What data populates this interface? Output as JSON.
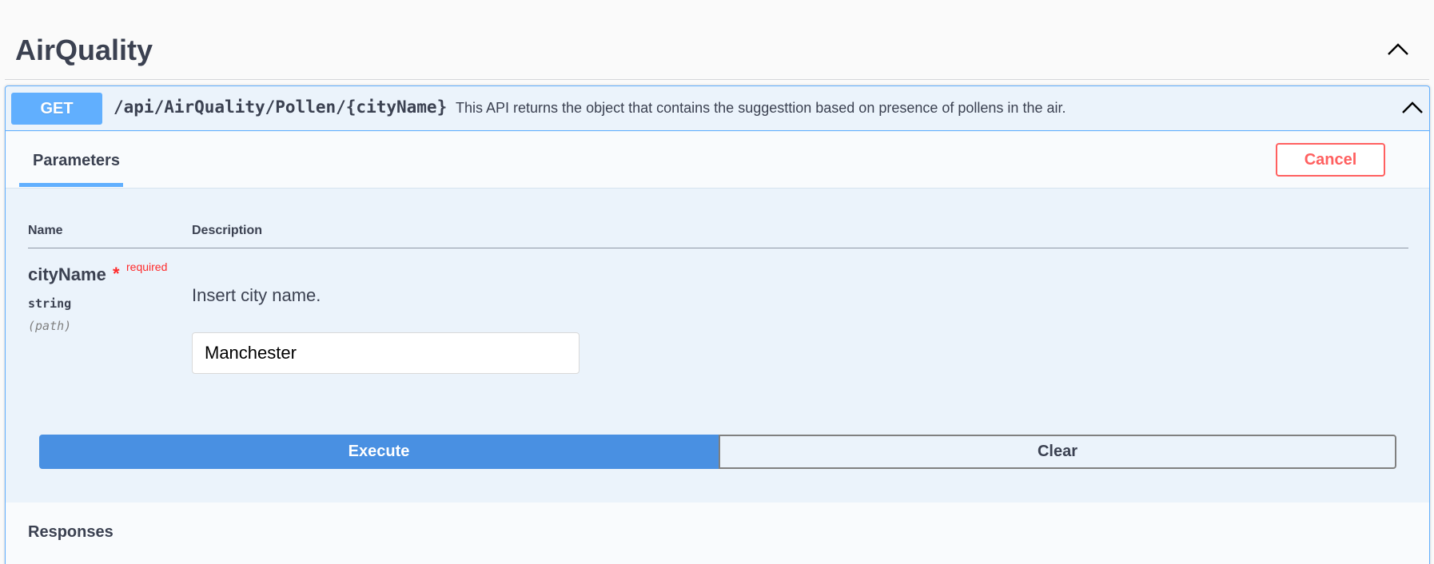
{
  "tag": {
    "title": "AirQuality",
    "collapse_icon": "chevron-up-icon"
  },
  "operation": {
    "method": "GET",
    "path": "/api/AirQuality/Pollen/{cityName}",
    "summary": "This API returns the object that contains the suggesttion based on presence of pollens in the air.",
    "collapse_icon": "chevron-up-icon",
    "method_color": "#61affe"
  },
  "parameters_section": {
    "tab_label": "Parameters",
    "cancel_label": "Cancel",
    "columns": {
      "name": "Name",
      "description": "Description"
    },
    "params": [
      {
        "name": "cityName",
        "required_star": "*",
        "required_label": "required",
        "type": "string",
        "in": "(path)",
        "description": "Insert city name.",
        "value": "Manchester"
      }
    ]
  },
  "actions": {
    "execute_label": "Execute",
    "clear_label": "Clear",
    "execute_color": "#4990e2"
  },
  "responses": {
    "title": "Responses"
  }
}
